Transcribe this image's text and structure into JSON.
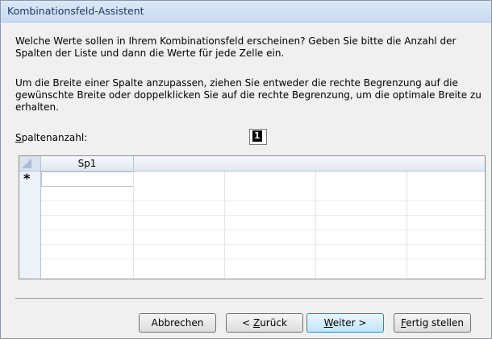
{
  "window": {
    "title": "Kombinationsfeld-Assistent"
  },
  "instructions": {
    "paragraph1": "Welche Werte sollen in Ihrem Kombinationsfeld erscheinen? Geben Sie bitte die Anzahl der Spalten der Liste und dann die Werte für jede Zelle ein.",
    "paragraph2": "Um die Breite einer Spalte anzupassen, ziehen Sie entweder die rechte Begrenzung auf die gewünschte Breite oder doppelklicken Sie auf die rechte Begrenzung, um die optimale Breite zu erhalten."
  },
  "column_count": {
    "label_accel": "S",
    "label_rest": "paltenanzahl:",
    "value": "1"
  },
  "grid": {
    "columns": [
      "Sp1"
    ],
    "new_row_marker": "*"
  },
  "buttons": {
    "cancel": {
      "label": "Abbrechen"
    },
    "back": {
      "prefix": "< ",
      "accel": "Z",
      "rest": "urück"
    },
    "next": {
      "accel": "W",
      "rest": "eiter >"
    },
    "finish": {
      "accel": "F",
      "rest": "ertig stellen"
    }
  }
}
